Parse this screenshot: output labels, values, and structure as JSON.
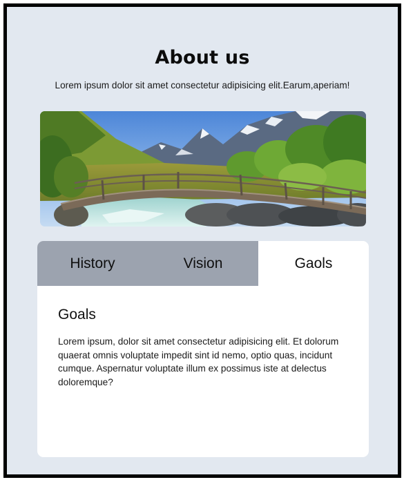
{
  "page": {
    "title": "About us",
    "subtitle": "Lorem ipsum dolor sit amet consectetur adipisicing elit.Earum,aperiam!"
  },
  "tabs": [
    {
      "label": "History",
      "active": false
    },
    {
      "label": "Vision",
      "active": false
    },
    {
      "label": "Gaols",
      "active": true
    }
  ],
  "panel": {
    "heading": "Goals",
    "text": "Lorem ipsum, dolor sit amet consectetur adipisicing elit. Et dolorum quaerat omnis voluptate impedit sint id nemo, optio quas, incidunt cumque. Aspernatur voluptate illum ex possimus iste at delectus doloremque?"
  },
  "colors": {
    "background": "#e2e8f0",
    "frame_border": "#000000",
    "tab_inactive": "#9ca3af",
    "tab_active": "#ffffff",
    "card": "#ffffff"
  }
}
